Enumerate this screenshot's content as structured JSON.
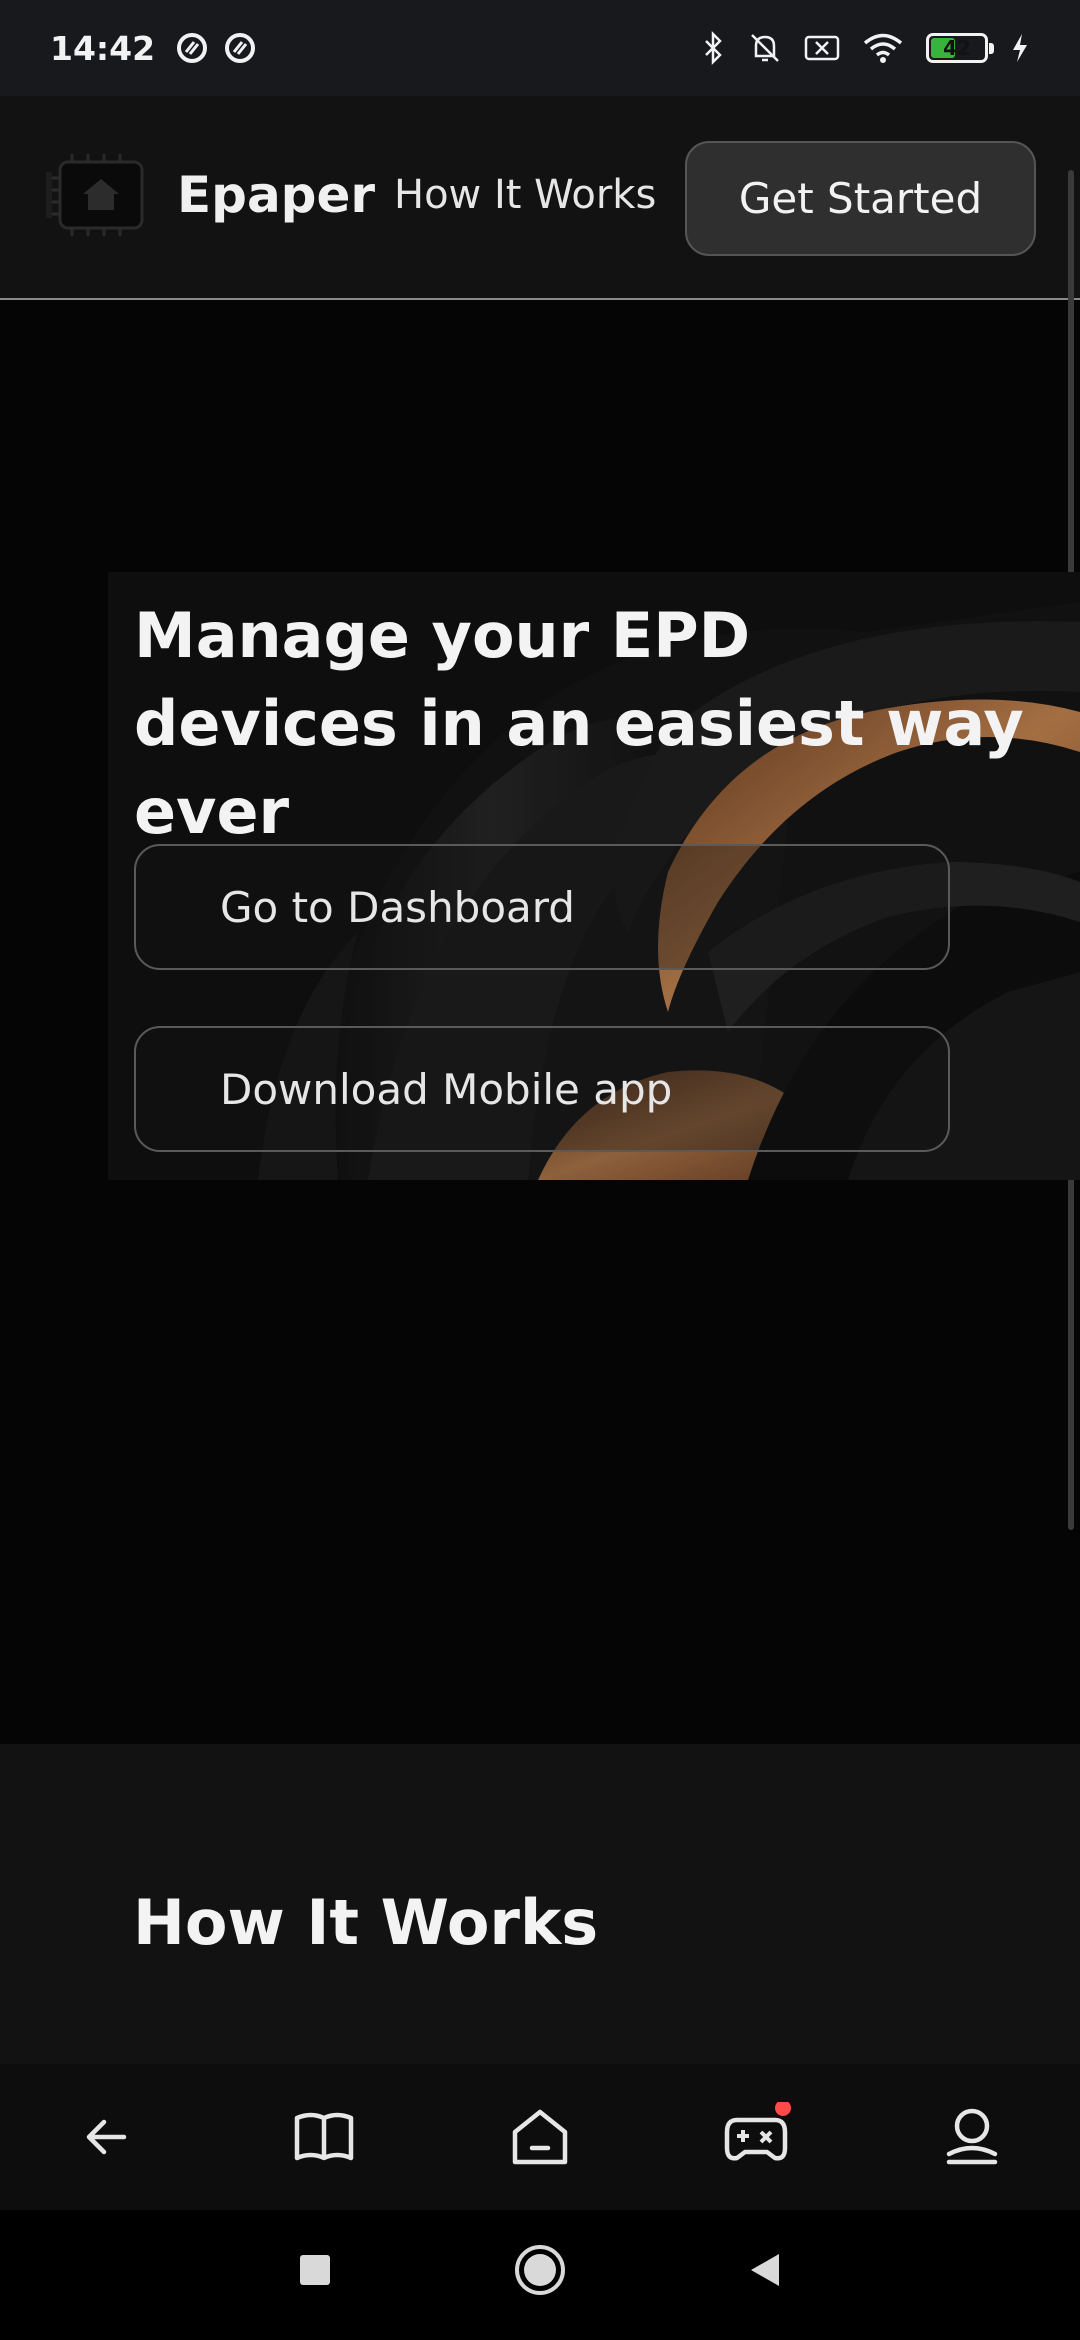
{
  "status_bar": {
    "time": "14:42",
    "battery_level": "42",
    "left_icons": [
      "sync-a-icon",
      "sync-b-icon"
    ],
    "right_icons": [
      "bluetooth-icon",
      "bell-off-icon",
      "no-sim-icon",
      "wifi-icon",
      "battery-icon",
      "charging-icon"
    ]
  },
  "header": {
    "brand": "Epaper",
    "nav_how_it_works": "How It Works",
    "cta_label": "Get Started"
  },
  "hero": {
    "title": "Manage your EPD devices in an easiest way ever",
    "primary_button": "Go to Dashboard",
    "secondary_button": "Download Mobile app"
  },
  "section_how": {
    "title": "How It Works"
  },
  "browser_toolbar": {
    "icons": [
      "back-arrow-icon",
      "book-icon",
      "home-icon",
      "gamepad-icon",
      "profile-icon"
    ]
  },
  "system_nav": {
    "icons": [
      "recents-square-icon",
      "home-circle-icon",
      "back-triangle-icon"
    ]
  },
  "colors": {
    "accent_swirl": "#b87443",
    "page_background": "#050505",
    "header_background": "#121212",
    "notification_dot": "#ff4a4a"
  }
}
